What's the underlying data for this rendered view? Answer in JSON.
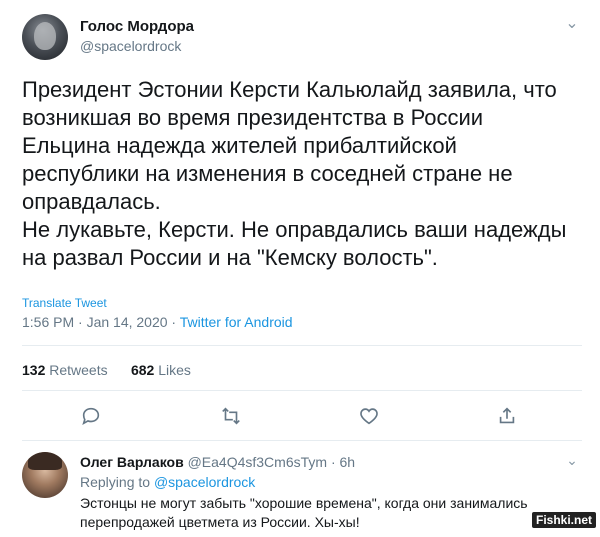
{
  "tweet": {
    "author_name": "Голос Мордора",
    "author_handle": "@spacelordrock",
    "text_lines": [
      "Президент Эстонии Керсти Кальюлайд заявила, что",
      "возникшая во время президентства в России",
      "Ельцина надежда жителей прибалтийской",
      "республики на изменения в соседней стране не",
      "оправдалась.",
      "Не лукавьте, Керсти. Не оправдались ваши надежды",
      "на развал России и на \"Кемску волость\"."
    ],
    "translate_label": "Translate Tweet",
    "timestamp": "1:56 PM · Jan 14, 2020 · ",
    "source": "Twitter for Android",
    "retweets_count": "132",
    "retweets_label": "Retweets",
    "likes_count": "682",
    "likes_label": "Likes",
    "more_icon": "chevron-down-icon"
  },
  "actions": {
    "reply_icon": "reply-icon",
    "retweet_icon": "retweet-icon",
    "like_icon": "heart-icon",
    "share_icon": "share-icon"
  },
  "reply": {
    "author_name": "Олег Варлаков",
    "author_handle": "@Ea4Q4sf3Cm6sTym",
    "time": " · 6h",
    "replying_prefix": "Replying to ",
    "replying_to": "@spacelordrock",
    "text": "Эстонцы не могут забыть \"хорошие времена\", когда они занимались перепродажей цветмета из России. Хы-хы!"
  },
  "watermark": "Fishki.net",
  "colors": {
    "accent": "#1b95e0",
    "secondary_text": "#657786",
    "divider": "#e6ecf0"
  }
}
